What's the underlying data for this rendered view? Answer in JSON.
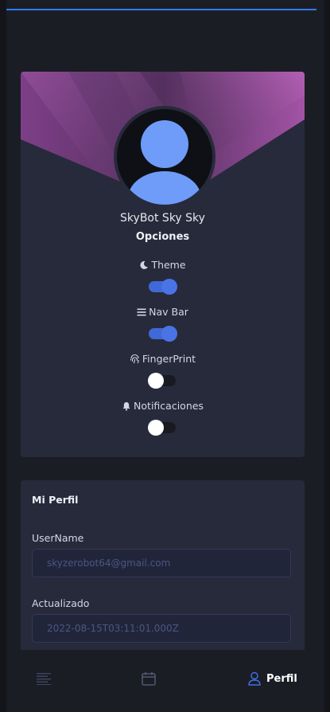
{
  "profile": {
    "name": "SkyBot Sky Sky",
    "options_title": "Opciones",
    "options": [
      {
        "label": "Theme",
        "icon": "moon-icon",
        "enabled": true
      },
      {
        "label": "Nav Bar",
        "icon": "menu-icon",
        "enabled": true
      },
      {
        "label": "FingerPrint",
        "icon": "fingerprint-icon",
        "enabled": false
      },
      {
        "label": "Notificaciones",
        "icon": "bell-icon",
        "enabled": false
      }
    ]
  },
  "form": {
    "title": "Mi Perfil",
    "username_label": "UserName",
    "username_value": "skyzerobot64@gmail.com",
    "updated_label": "Actualizado",
    "updated_value": "2022-08-15T03:11:01.000Z"
  },
  "nav": {
    "items": [
      {
        "icon": "list-icon",
        "active": false
      },
      {
        "icon": "calendar-icon",
        "active": false
      },
      {
        "icon": "user-icon",
        "label": "Perfil",
        "active": true
      }
    ]
  },
  "colors": {
    "accent": "#4a74e6",
    "top_line": "#2f7bf0",
    "card_bg": "#272a3a",
    "banner_purple": "#a453a8"
  }
}
